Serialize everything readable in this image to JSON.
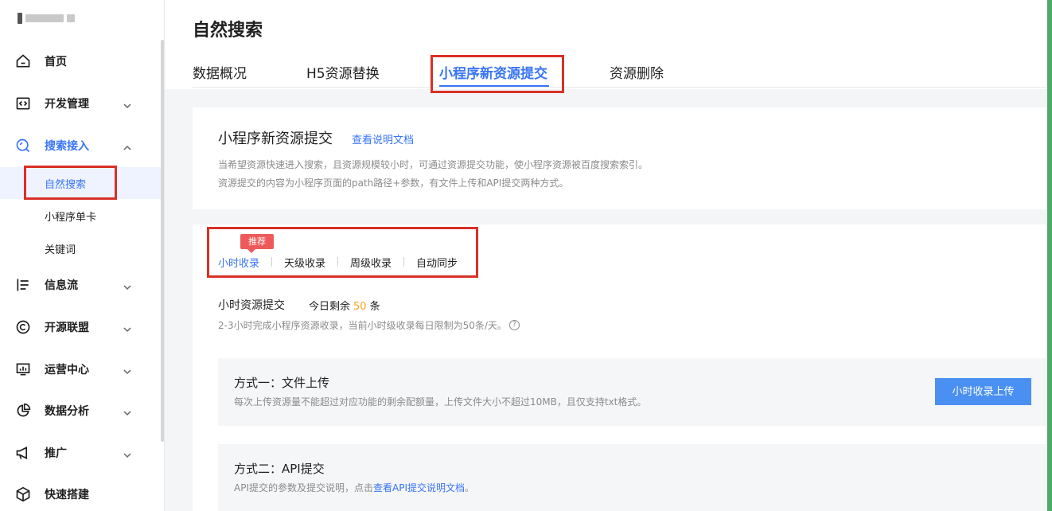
{
  "sidebar": {
    "app_name": "",
    "items": [
      {
        "label": "首页",
        "icon": "home-icon",
        "has_chevron": false
      },
      {
        "label": "开发管理",
        "icon": "code-icon",
        "has_chevron": true
      },
      {
        "label": "搜索接入",
        "icon": "search-icon",
        "has_chevron": true,
        "expanded": true
      },
      {
        "label": "信息流",
        "icon": "feed-icon",
        "has_chevron": true
      },
      {
        "label": "开源联盟",
        "icon": "copyright-icon",
        "has_chevron": true
      },
      {
        "label": "运营中心",
        "icon": "operations-icon",
        "has_chevron": true
      },
      {
        "label": "数据分析",
        "icon": "pie-chart-icon",
        "has_chevron": true
      },
      {
        "label": "推广",
        "icon": "megaphone-icon",
        "has_chevron": true
      },
      {
        "label": "快速搭建",
        "icon": "cube-icon",
        "has_chevron": false
      }
    ],
    "sub_items": [
      {
        "label": "自然搜索",
        "active": true
      },
      {
        "label": "小程序单卡"
      },
      {
        "label": "关键词"
      }
    ]
  },
  "main": {
    "page_title": "自然搜索",
    "tabs": [
      {
        "label": "数据概况"
      },
      {
        "label": "H5资源替换"
      },
      {
        "label": "小程序新资源提交",
        "active": true
      },
      {
        "label": "资源删除"
      }
    ],
    "intro": {
      "title": "小程序新资源提交",
      "doc_link": "查看说明文档",
      "desc_line1": "当希望资源快速进入搜索，且资源规模较小时，可通过资源提交功能，使小程序资源被百度搜索索引。",
      "desc_line2": "资源提交的内容为小程序页面的path路径+参数，有文件上传和API提交两种方式。"
    },
    "submit": {
      "badge": "推荐",
      "subtabs": [
        {
          "label": "小时收录",
          "active": true
        },
        {
          "label": "天级收录"
        },
        {
          "label": "周级收录"
        },
        {
          "label": "自动同步"
        }
      ],
      "section_title": "小时资源提交",
      "quota_prefix": "今日剩余",
      "quota_value": "50",
      "quota_suffix": "条",
      "section_desc": "2-3小时完成小程序资源收录，当前小时级收录每日限制为50条/天。",
      "method1": {
        "title": "方式一：文件上传",
        "desc": "每次上传资源量不能超过对应功能的剩余配额量，上传文件大小不超过10MB，且仅支持txt格式。",
        "button": "小时收录上传"
      },
      "method2": {
        "title": "方式二：API提交",
        "desc_prefix": "API提交的参数及提交说明，点击",
        "link": "查看API提交说明文档",
        "desc_suffix": "。"
      }
    }
  },
  "colors": {
    "accent": "#3874f6",
    "highlight_box": "#d93026",
    "badge": "#ee5a5a",
    "quota_number": "#f5a623",
    "button": "#4a90f2"
  }
}
